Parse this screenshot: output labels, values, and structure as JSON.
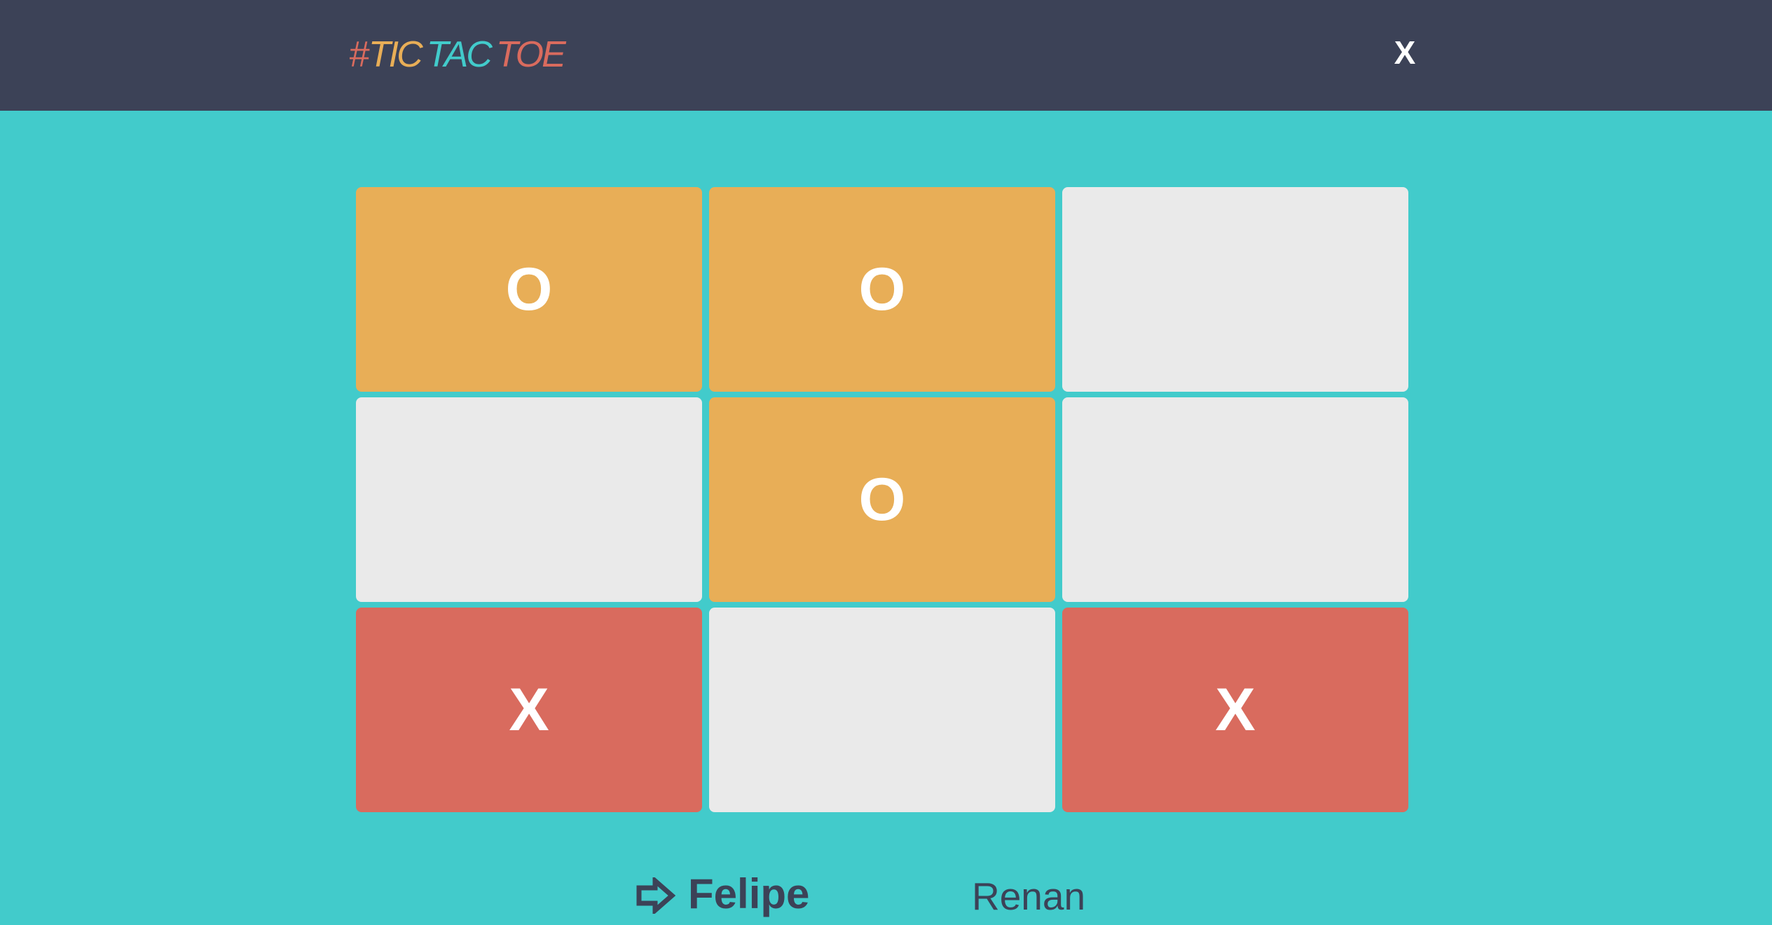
{
  "header": {
    "logo": {
      "hash": "#",
      "tic": "TIC",
      "tac": "TAC",
      "toe": "TOE"
    },
    "reset_label": "X"
  },
  "board": {
    "cells": [
      "O",
      "O",
      "",
      "",
      "O",
      "",
      "X",
      "",
      "X"
    ]
  },
  "players": {
    "current_turn_icon": "right-arrow-outline-icon",
    "player_1": {
      "name": "Felipe"
    },
    "player_2": {
      "name": "Renan"
    }
  },
  "colors": {
    "header_bg": "#3C4257",
    "page_bg": "#42CBCB",
    "o_cell": "#E8AE57",
    "x_cell": "#D96B5E",
    "empty_cell": "#EAEAEA",
    "text_dark": "#3C4257"
  }
}
